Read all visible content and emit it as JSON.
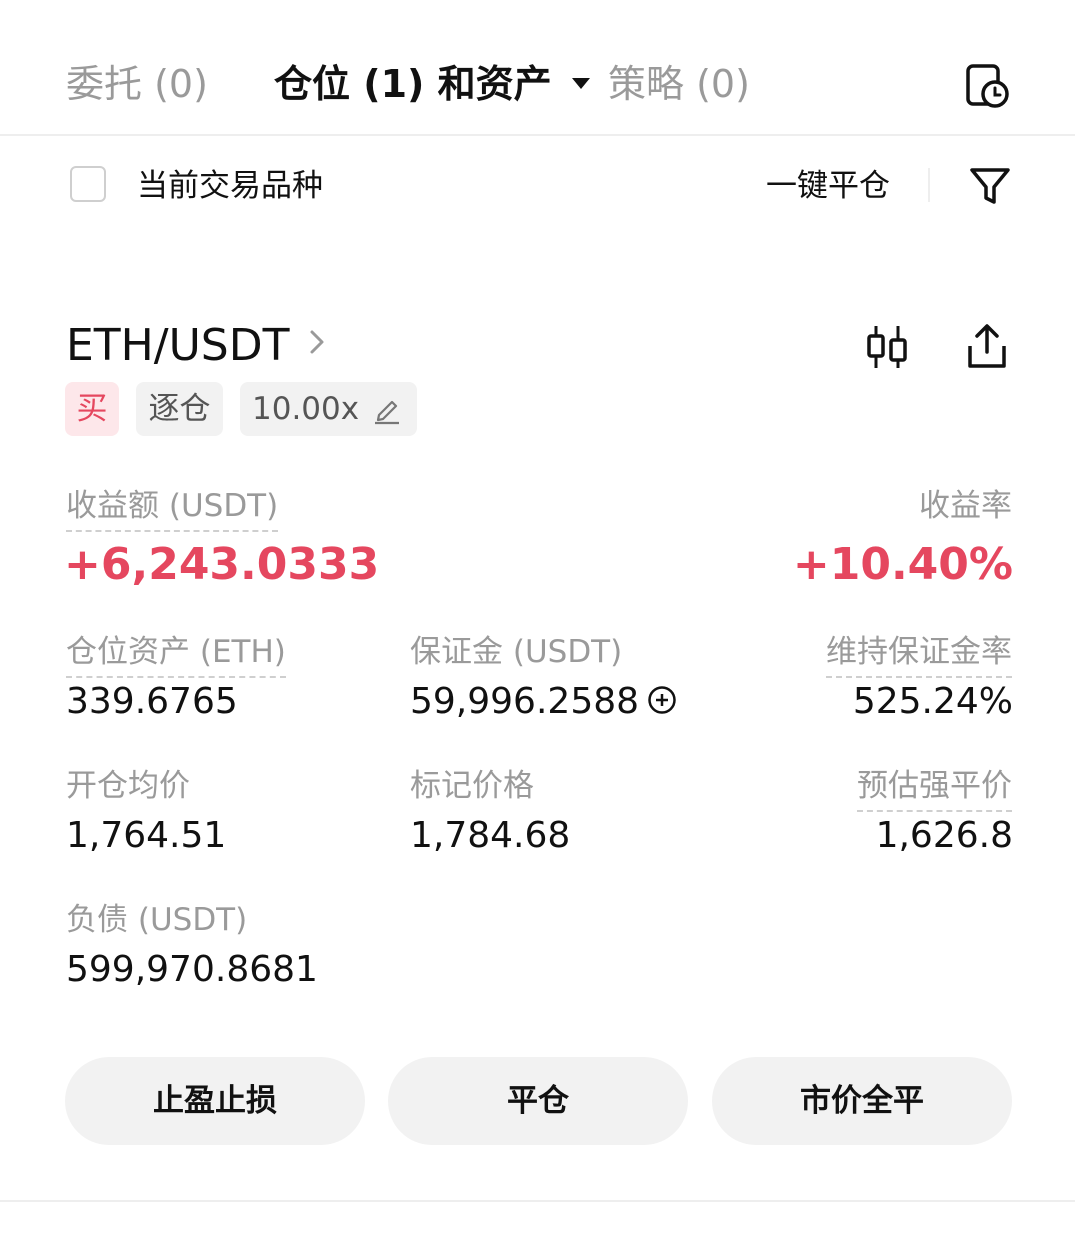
{
  "tabs": {
    "orders": "委托 (0)",
    "positions": "仓位 (1) 和资产",
    "strategies": "策略 (0)"
  },
  "filter": {
    "current_symbol_label": "当前交易品种",
    "close_all_label": "一键平仓"
  },
  "position": {
    "pair": "ETH/USDT",
    "side": "买",
    "margin_mode": "逐仓",
    "leverage": "10.00x",
    "pnl_label": "收益额 (USDT)",
    "pnl_value": "+6,243.0333",
    "pnl_rate_label": "收益率",
    "pnl_rate_value": "+10.40%",
    "size_label": "仓位资产 (ETH)",
    "size_value": "339.6765",
    "margin_label": "保证金 (USDT)",
    "margin_value": "59,996.2588",
    "mmr_label": "维持保证金率",
    "mmr_value": "525.24%",
    "entry_label": "开仓均价",
    "entry_value": "1,764.51",
    "mark_label": "标记价格",
    "mark_value": "1,784.68",
    "liq_label": "预估强平价",
    "liq_value": "1,626.8",
    "debt_label": "负债 (USDT)",
    "debt_value": "599,970.8681"
  },
  "actions": {
    "tpsl": "止盈止损",
    "close": "平仓",
    "market_close": "市价全平"
  },
  "colors": {
    "profit": "#e5475f",
    "muted": "#9a9a9a",
    "button_bg": "#f2f2f2"
  }
}
